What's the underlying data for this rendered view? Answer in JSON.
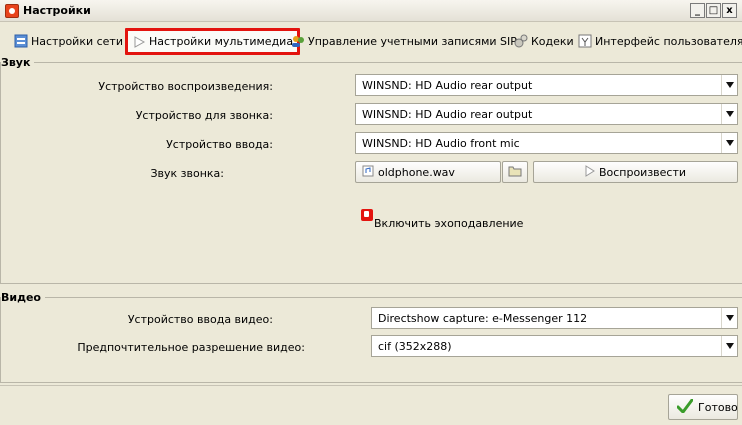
{
  "window": {
    "title": "Настройки",
    "minimize": "_",
    "maximize": "□",
    "close": "x"
  },
  "tabs": [
    {
      "label": "Настройки сети",
      "icon": "network-icon"
    },
    {
      "label": "Настройки мультимедиа",
      "icon": "play-icon",
      "active": true
    },
    {
      "label": "Управление учетными записями SIP",
      "icon": "users-icon"
    },
    {
      "label": "Кодеки",
      "icon": "gears-icon"
    },
    {
      "label": "Интерфейс пользователя",
      "icon": "ui-icon"
    }
  ],
  "sound": {
    "title": "Звук",
    "playback_label": "Устройство воспроизведения:",
    "playback_value": "WINSND: HD Audio rear output",
    "ring_label": "Устройство для звонка:",
    "ring_value": "WINSND: HD Audio rear output",
    "input_label": "Устройство ввода:",
    "input_value": "WINSND: HD Audio front mic",
    "ringtone_label": "Звук звонка:",
    "ringtone_file": "oldphone.wav",
    "play_label": "Воспроизвести",
    "echo_label": "Включить эхоподавление"
  },
  "video": {
    "title": "Видео",
    "input_label": "Устройство ввода видео:",
    "input_value": "Directshow capture: e-Messenger 112",
    "resolution_label": "Предпочтительное разрешение видео:",
    "resolution_value": "cif (352x288)"
  },
  "done_label": "Готово",
  "colors": {
    "highlight": "#e3140f",
    "background": "#ece9d8",
    "check": "#3a9c2a"
  }
}
